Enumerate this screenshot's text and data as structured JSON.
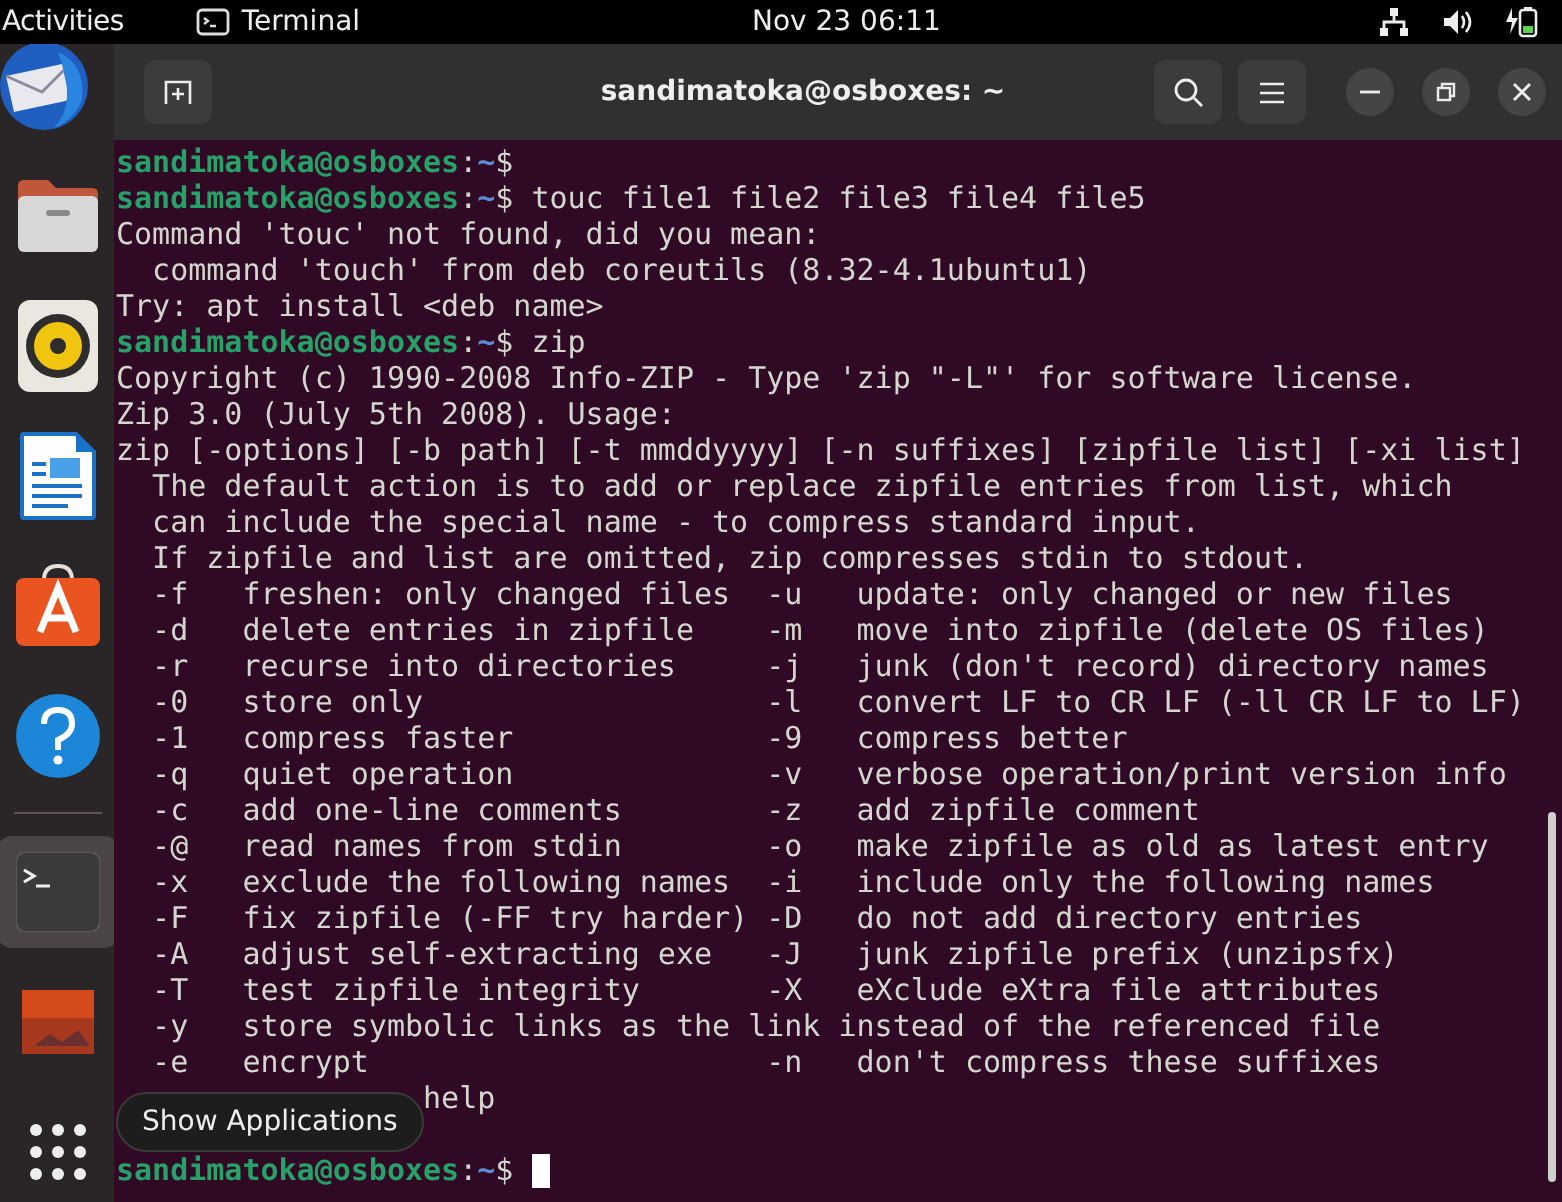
{
  "top_bar": {
    "activities": "Activities",
    "app_name": "Terminal",
    "clock": "Nov 23  06:11"
  },
  "dock": {
    "items": [
      {
        "kind": "mail",
        "active": false
      },
      {
        "kind": "files",
        "active": false
      },
      {
        "kind": "music",
        "active": false
      },
      {
        "kind": "writer",
        "active": false
      },
      {
        "kind": "appcenter",
        "active": false
      },
      {
        "kind": "help",
        "active": false
      },
      {
        "kind": "separator"
      },
      {
        "kind": "terminal",
        "active": true
      },
      {
        "kind": "partial",
        "active": false
      },
      {
        "kind": "apps",
        "active": false
      }
    ],
    "tooltip": "Show Applications"
  },
  "window": {
    "title": "sandimatoka@osboxes: ~"
  },
  "terminal": {
    "lines": [
      {
        "kind": "prompt",
        "user_host": "sandimatoka@osboxes",
        "separator": ":",
        "path": "~",
        "symbol": "$"
      },
      {
        "kind": "prompt",
        "user_host": "sandimatoka@osboxes",
        "separator": ":",
        "path": "~",
        "symbol": "$",
        "command": " touc file1 file2 file3 file4 file5"
      },
      {
        "kind": "output",
        "text": "Command 'touc' not found, did you mean:"
      },
      {
        "kind": "output",
        "text": "  command 'touch' from deb coreutils (8.32-4.1ubuntu1)"
      },
      {
        "kind": "output",
        "text": "Try: apt install <deb name>"
      },
      {
        "kind": "prompt",
        "user_host": "sandimatoka@osboxes",
        "separator": ":",
        "path": "~",
        "symbol": "$",
        "command": " zip"
      },
      {
        "kind": "output",
        "text": "Copyright (c) 1990-2008 Info-ZIP - Type 'zip \"-L\"' for software license."
      },
      {
        "kind": "output",
        "text": "Zip 3.0 (July 5th 2008). Usage:"
      },
      {
        "kind": "output",
        "text": "zip [-options] [-b path] [-t mmddyyyy] [-n suffixes] [zipfile list] [-xi list]"
      },
      {
        "kind": "output",
        "text": "  The default action is to add or replace zipfile entries from list, which"
      },
      {
        "kind": "output",
        "text": "  can include the special name - to compress standard input."
      },
      {
        "kind": "output",
        "text": "  If zipfile and list are omitted, zip compresses stdin to stdout."
      },
      {
        "kind": "output",
        "text": "  -f   freshen: only changed files  -u   update: only changed or new files"
      },
      {
        "kind": "output",
        "text": "  -d   delete entries in zipfile    -m   move into zipfile (delete OS files)"
      },
      {
        "kind": "output",
        "text": "  -r   recurse into directories     -j   junk (don't record) directory names"
      },
      {
        "kind": "output",
        "text": "  -0   store only                   -l   convert LF to CR LF (-ll CR LF to LF)"
      },
      {
        "kind": "output",
        "text": "  -1   compress faster              -9   compress better"
      },
      {
        "kind": "output",
        "text": "  -q   quiet operation              -v   verbose operation/print version info"
      },
      {
        "kind": "output",
        "text": "  -c   add one-line comments        -z   add zipfile comment"
      },
      {
        "kind": "output",
        "text": "  -@   read names from stdin        -o   make zipfile as old as latest entry"
      },
      {
        "kind": "output",
        "text": "  -x   exclude the following names  -i   include only the following names"
      },
      {
        "kind": "output",
        "text": "  -F   fix zipfile (-FF try harder) -D   do not add directory entries"
      },
      {
        "kind": "output",
        "text": "  -A   adjust self-extracting exe   -J   junk zipfile prefix (unzipsfx)"
      },
      {
        "kind": "output",
        "text": "  -T   test zipfile integrity       -X   eXclude eXtra file attributes"
      },
      {
        "kind": "output",
        "text": "  -y   store symbolic links as the link instead of the referenced file"
      },
      {
        "kind": "output",
        "text": "  -e   encrypt                      -n   don't compress these suffixes"
      },
      {
        "kind": "output",
        "text": "                 help"
      },
      {
        "kind": "blank"
      },
      {
        "kind": "prompt",
        "user_host": "sandimatoka@osboxes",
        "separator": ":",
        "path": "~",
        "symbol": "$",
        "cursor": true
      }
    ]
  }
}
